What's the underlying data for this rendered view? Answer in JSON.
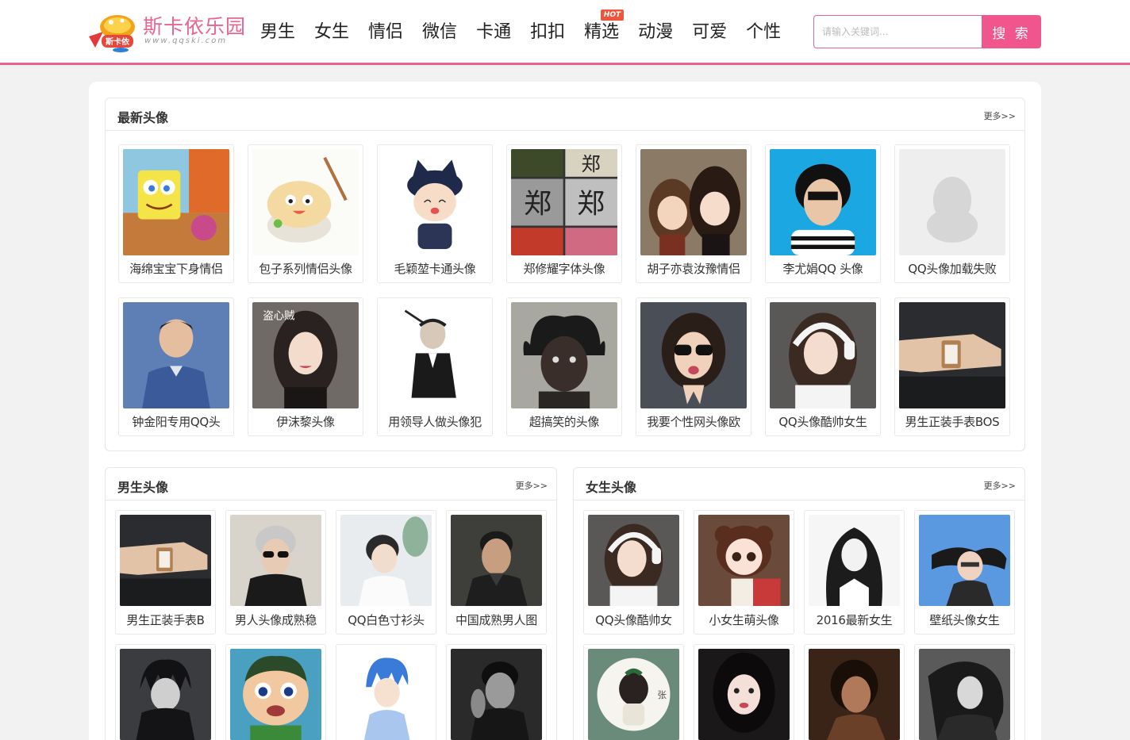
{
  "header": {
    "logo_title": "斯卡依乐园",
    "logo_url_text": "www.qqski.com",
    "logo_badge": "斯卡依",
    "nav": [
      {
        "label": "男生"
      },
      {
        "label": "女生"
      },
      {
        "label": "情侣"
      },
      {
        "label": "微信"
      },
      {
        "label": "卡通"
      },
      {
        "label": "扣扣"
      },
      {
        "label": "精选",
        "badge": "HOT"
      },
      {
        "label": "动漫"
      },
      {
        "label": "可爱"
      },
      {
        "label": "个性"
      }
    ],
    "search": {
      "placeholder": "请输入关键词...",
      "button_label": "搜 索"
    }
  },
  "latest": {
    "title": "最新头像",
    "more": "更多>>",
    "items": [
      {
        "caption": "海绵宝宝下身情侣",
        "img": "spongebob"
      },
      {
        "caption": "包子系列情侣头像",
        "img": "bun-cartoon"
      },
      {
        "caption": "毛颖堃卡通头像",
        "img": "cat-ear-boy"
      },
      {
        "caption": "郑修耀字体头像",
        "img": "calligraphy-collage"
      },
      {
        "caption": "胡子亦袁汝豫情侣",
        "img": "anime-couple"
      },
      {
        "caption": "李尤娟QQ 头像",
        "img": "short-hair-portrait"
      },
      {
        "caption": "QQ头像加载失败",
        "img": "penguin-placeholder"
      },
      {
        "caption": "钟金阳专用QQ头",
        "img": "man-blue-suit"
      },
      {
        "caption": "伊沫黎头像",
        "img": "girl-dark"
      },
      {
        "caption": "用领导人做头像犯",
        "img": "sketch-man"
      },
      {
        "caption": "超搞笑的头像",
        "img": "funny-face"
      },
      {
        "caption": "我要个性网头像欧",
        "img": "sunglasses-girl"
      },
      {
        "caption": "QQ头像酷帅女生",
        "img": "headphone-girl"
      },
      {
        "caption": "男生正装手表BOS",
        "img": "watch-wrist"
      }
    ]
  },
  "boys": {
    "title": "男生头像",
    "more": "更多>>",
    "items": [
      {
        "caption": "男生正装手表B",
        "img": "watch-wrist"
      },
      {
        "caption": "男人头像成熟稳",
        "img": "silver-hair-man"
      },
      {
        "caption": "QQ白色寸衫头",
        "img": "white-shirt-boy"
      },
      {
        "caption": "中国成熟男人图",
        "img": "mature-man"
      },
      {
        "caption": "",
        "img": "anime-dark-boy"
      },
      {
        "caption": "",
        "img": "crying-cartoon"
      },
      {
        "caption": "",
        "img": "blue-hair-anime"
      },
      {
        "caption": "",
        "img": "bw-man"
      }
    ]
  },
  "girls": {
    "title": "女生头像",
    "more": "更多>>",
    "items": [
      {
        "caption": "QQ头像酷帅女",
        "img": "headphone-girl"
      },
      {
        "caption": "小女生萌头像",
        "img": "cute-girl-doll"
      },
      {
        "caption": "2016最新女生",
        "img": "anime-girl-bw"
      },
      {
        "caption": "壁纸头像女生",
        "img": "sky-girl"
      },
      {
        "caption": "",
        "img": "circle-girl-back"
      },
      {
        "caption": "",
        "img": "dark-hair-girl"
      },
      {
        "caption": "",
        "img": "dark-portrait"
      },
      {
        "caption": "",
        "img": "bw-girl"
      }
    ]
  }
}
